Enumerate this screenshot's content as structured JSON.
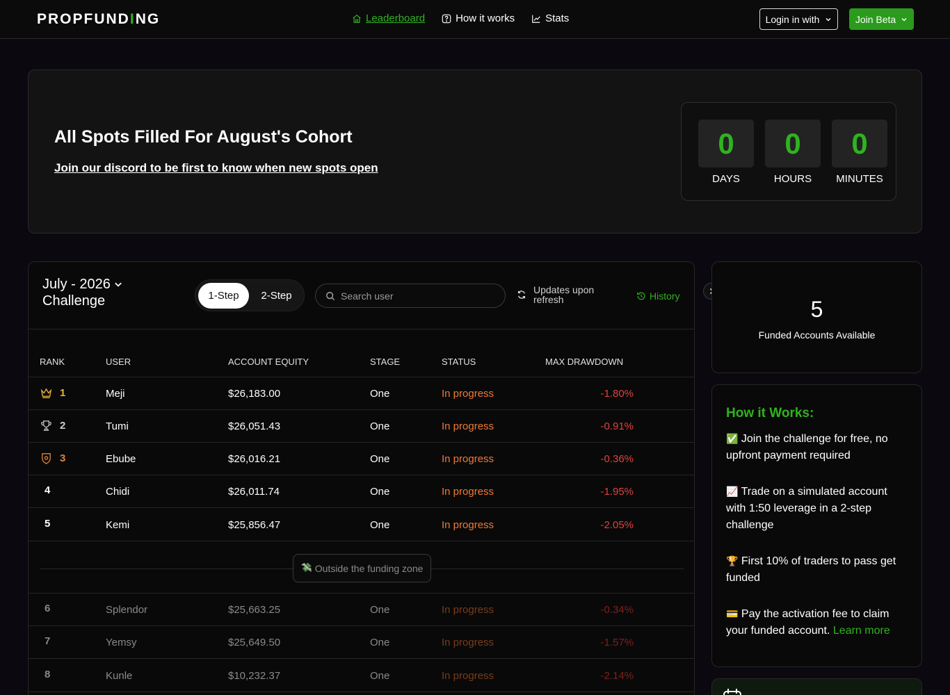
{
  "nav": {
    "logo_pre": "PROPFUND",
    "logo_mid": "I",
    "logo_post": "NG",
    "links": [
      {
        "label": "Leaderboard",
        "icon": "home-icon"
      },
      {
        "label": "How it works",
        "icon": "question-icon"
      },
      {
        "label": "Stats",
        "icon": "chart-icon"
      }
    ],
    "login_label": "Login in with",
    "join_label": "Join Beta"
  },
  "hero": {
    "title": "All Spots Filled For August's Cohort",
    "link": "Join our discord to be first to know when new spots open",
    "countdown": [
      {
        "value": "0",
        "label": "DAYS"
      },
      {
        "value": "0",
        "label": "HOURS"
      },
      {
        "value": "0",
        "label": "MINUTES"
      }
    ]
  },
  "board": {
    "challenge_line1": "July - 2026",
    "challenge_line2": "Challenge",
    "toggle": [
      "1-Step",
      "2-Step"
    ],
    "search_placeholder": "Search user",
    "refresh_line1": "Updates upon",
    "refresh_line2": "refresh",
    "history_label": "History",
    "columns": [
      "RANK",
      "USER",
      "ACCOUNT EQUITY",
      "STAGE",
      "STATUS",
      "MAX DRAWDOWN"
    ],
    "rows": [
      {
        "rank": "1",
        "user": "Meji",
        "equity": "$26,183.00",
        "stage": "One",
        "status": "In progress",
        "drawdown": "-1.80%"
      },
      {
        "rank": "2",
        "user": "Tumi",
        "equity": "$26,051.43",
        "stage": "One",
        "status": "In progress",
        "drawdown": "-0.91%"
      },
      {
        "rank": "3",
        "user": "Ebube",
        "equity": "$26,016.21",
        "stage": "One",
        "status": "In progress",
        "drawdown": "-0.36%"
      },
      {
        "rank": "4",
        "user": "Chidi",
        "equity": "$26,011.74",
        "stage": "One",
        "status": "In progress",
        "drawdown": "-1.95%"
      },
      {
        "rank": "5",
        "user": "Kemi",
        "equity": "$25,856.47",
        "stage": "One",
        "status": "In progress",
        "drawdown": "-2.05%"
      }
    ],
    "zone_label": "Outside the funding zone",
    "outside_rows": [
      {
        "rank": "6",
        "user": "Splendor",
        "equity": "$25,663.25",
        "stage": "One",
        "status": "In progress",
        "drawdown": "-0.34%"
      },
      {
        "rank": "7",
        "user": "Yemsy",
        "equity": "$25,649.50",
        "stage": "One",
        "status": "In progress",
        "drawdown": "-1.57%"
      },
      {
        "rank": "8",
        "user": "Kunle",
        "equity": "$10,232.37",
        "stage": "One",
        "status": "In progress",
        "drawdown": "-2.14%"
      }
    ]
  },
  "sidebar": {
    "funded_count": "5",
    "funded_label": "Funded Accounts Available",
    "how_title": "How it Works:",
    "how_items": [
      {
        "emoji": "✅",
        "text": "Join the challenge for free, no upfront payment required"
      },
      {
        "emoji": "📈",
        "text": "Trade on a simulated account with 1:50 leverage in a 2-step challenge"
      },
      {
        "emoji": "🏆",
        "text": "First 10% of traders to pass get funded"
      },
      {
        "emoji": "💳",
        "text": "Pay the activation fee to claim your funded account."
      }
    ],
    "learn_more": "Learn more"
  },
  "colors": {
    "accent": "#2fb31f",
    "status": "#f07a34",
    "drawdown": "#e0413d",
    "gold": "#e8b43a",
    "bronze": "#e0823a"
  }
}
